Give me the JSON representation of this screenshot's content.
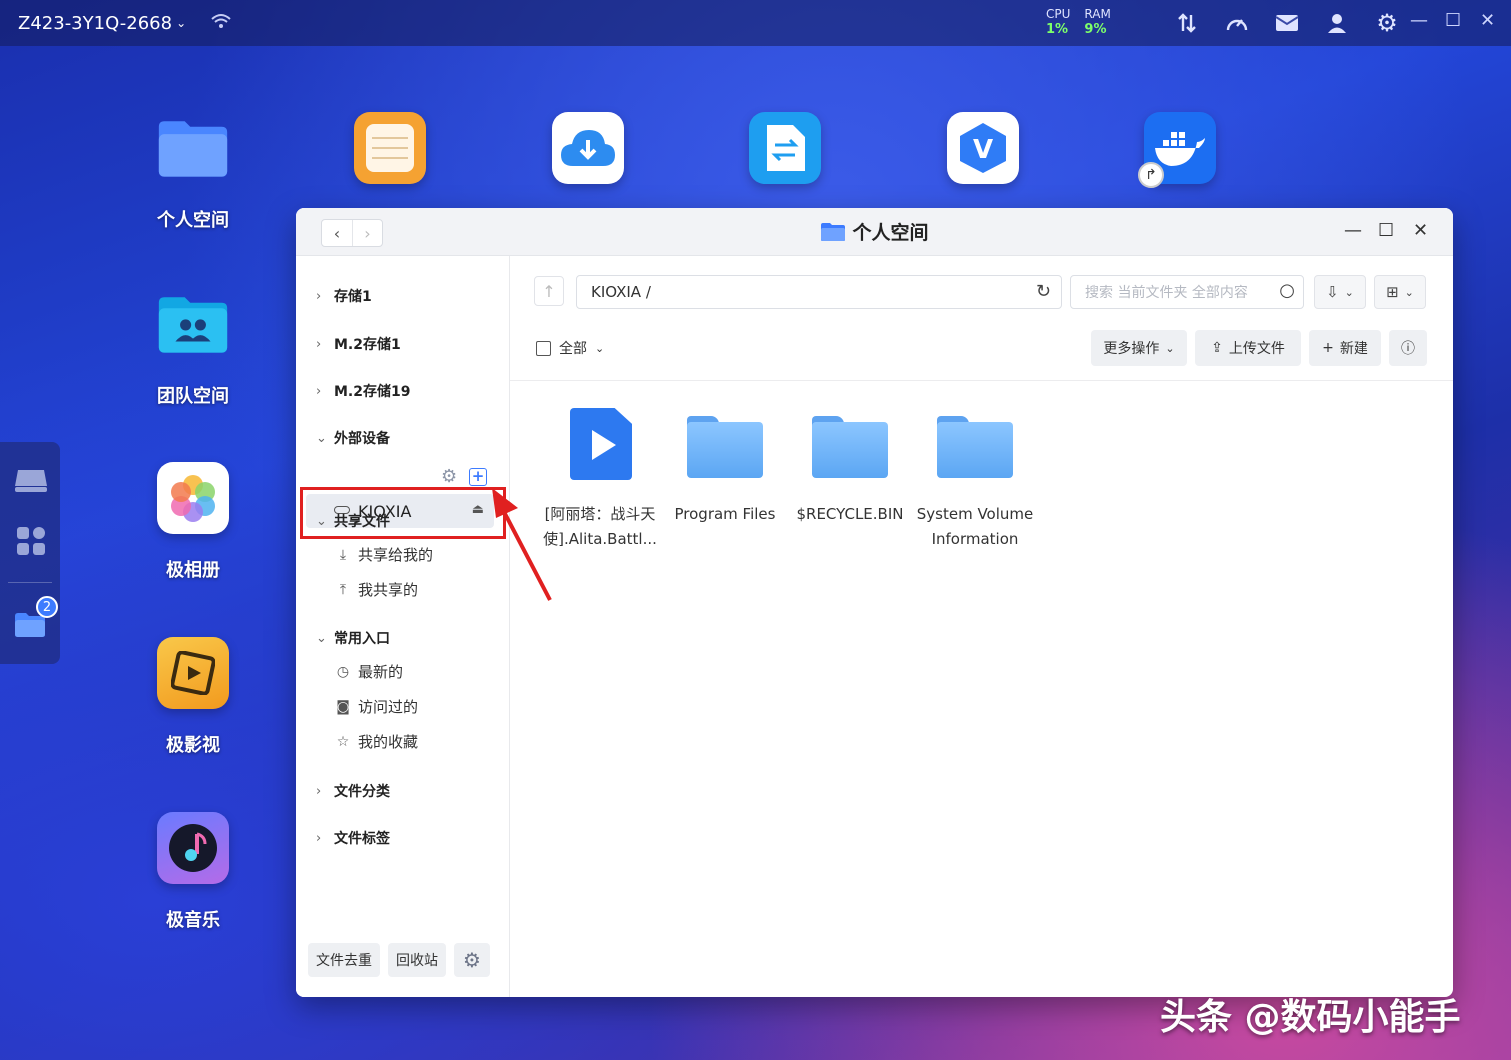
{
  "topbar": {
    "device_name": "Z423-3Y1Q-2668",
    "cpu_label": "CPU",
    "cpu_value": "1%",
    "ram_label": "RAM",
    "ram_value": "9%"
  },
  "desktop": {
    "icons": [
      {
        "label": "个人空间"
      },
      {
        "label": "团队空间"
      },
      {
        "label": "极相册"
      },
      {
        "label": "极影视"
      },
      {
        "label": "极音乐"
      }
    ]
  },
  "dock": {
    "badge": "2"
  },
  "window": {
    "title": "个人空间",
    "sidebar": {
      "storage": [
        "存储1",
        "M.2存储1",
        "M.2存储19"
      ],
      "external_section": "外部设备",
      "external_device": "KIOXIA",
      "shared_section": "共享文件",
      "shared_items": [
        "共享给我的",
        "我共享的"
      ],
      "common_section": "常用入口",
      "common_items": [
        "最新的",
        "访问过的",
        "我的收藏"
      ],
      "category_section": "文件分类",
      "tag_section": "文件标签",
      "bottom_buttons": [
        "文件去重",
        "回收站"
      ]
    },
    "main": {
      "path": "KIOXIA /",
      "search_placeholder": "搜索 当前文件夹 全部内容",
      "select_all": "全部",
      "more_actions": "更多操作",
      "upload": "上传文件",
      "new": "新建",
      "files": [
        {
          "name_line1": "[阿丽塔：战斗天",
          "name_line2": "使].Alita.Battl...",
          "type": "video"
        },
        {
          "name_line1": "Program Files",
          "name_line2": "",
          "type": "folder"
        },
        {
          "name_line1": "$RECYCLE.BIN",
          "name_line2": "",
          "type": "folder"
        },
        {
          "name_line1": "System Volume",
          "name_line2": "Information",
          "type": "folder"
        }
      ]
    }
  },
  "watermark": "头条 @数码小能手",
  "colors": {
    "accent": "#3d7bff",
    "highlight_box": "#e02020",
    "stat_value": "#7dff6a"
  }
}
